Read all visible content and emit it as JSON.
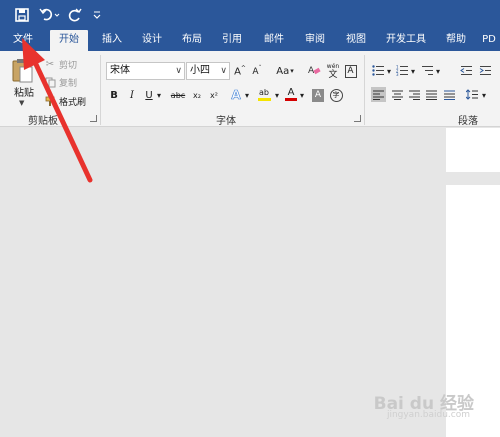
{
  "quick_access": {
    "save": "save-icon",
    "undo": "undo-icon",
    "redo": "redo-icon",
    "customize": "customize-icon"
  },
  "tabs": [
    {
      "label": "文件"
    },
    {
      "label": "开始"
    },
    {
      "label": "插入"
    },
    {
      "label": "设计"
    },
    {
      "label": "布局"
    },
    {
      "label": "引用"
    },
    {
      "label": "邮件"
    },
    {
      "label": "审阅"
    },
    {
      "label": "视图"
    },
    {
      "label": "开发工具"
    },
    {
      "label": "帮助"
    },
    {
      "label": "PD"
    }
  ],
  "clipboard": {
    "paste": "粘贴",
    "cut": "剪切",
    "copy": "复制",
    "format_painter": "格式刷",
    "group_label": "剪贴板"
  },
  "font": {
    "font_name": "宋体",
    "font_size": "小四",
    "case_label": "Aa",
    "pinyin_top": "wén",
    "pinyin_bottom": "文",
    "border_char": "A",
    "bold": "B",
    "italic": "I",
    "underline": "U",
    "strike": "abc",
    "subscript": "x₂",
    "superscript": "x²",
    "effects_char": "A",
    "highlight_char": "ab",
    "font_color_char": "A",
    "shade_char": "A",
    "enclose_char": "字",
    "group_label": "字体"
  },
  "paragraph": {
    "group_label": "段落"
  },
  "colors": {
    "title_bar": "#2b579a",
    "ribbon": "#f3f3f3",
    "canvas": "#e6e6e6",
    "arrow": "#e8322d",
    "highlight_yellow": "#f5e400",
    "font_red": "#d40000"
  },
  "watermark": {
    "text": "Bai du 经验",
    "sub": "jingyan.baidu.com"
  }
}
